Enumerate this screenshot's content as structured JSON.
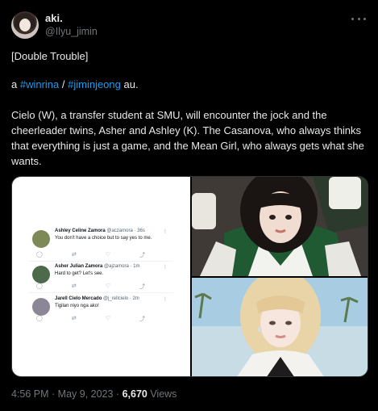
{
  "author": {
    "display_name": "aki.",
    "handle": "@Ilyu_jimin"
  },
  "tweet": {
    "line1": "[Double Trouble]",
    "line2_prefix": "a ",
    "hashtag1": "#winrina",
    "line2_sep": " / ",
    "hashtag2": "#jiminjeong",
    "line2_suffix": " au.",
    "line3": "Cielo (W), a transfer student at SMU, will encounter the jock and the cheerleader twins, Asher and Ashley (K). The Casanova, who always thinks that everything is just a game, and the Mean Girl, who always gets what she wants."
  },
  "mock_tweets": [
    {
      "name": "Ashley Celine Zamora",
      "meta": "@aczamora · 36s",
      "text": "You don't have a choice but to say yes to me."
    },
    {
      "name": "Asher Julian Zamora",
      "meta": "@ajzamora · 1m",
      "text": "Hard to get? Let's see."
    },
    {
      "name": "Jarell Cielo Mercado",
      "meta": "@j_rellcielo · 2m",
      "text": "Tigilan niyo nga ako!"
    }
  ],
  "mock_icons": [
    "reply-icon",
    "retweet-icon",
    "like-icon",
    "share-icon"
  ],
  "footer": {
    "time": "4:56 PM · May 9, 2023 · ",
    "views_count": "6,670",
    "views_label": " Views"
  },
  "colors": {
    "background": "#000000",
    "text": "#e7e9ea",
    "muted": "#71767b",
    "link": "#1d9bf0"
  }
}
